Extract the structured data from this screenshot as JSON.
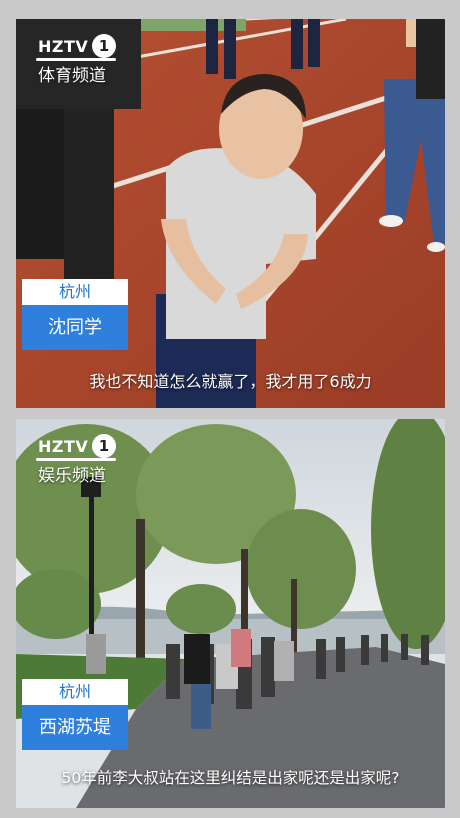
{
  "cards": [
    {
      "logo": {
        "brand": "HZTV",
        "number": "1",
        "channel": "体育频道"
      },
      "location": "杭州",
      "name": "沈同学",
      "caption": "我也不知道怎么就赢了，我才用了6成力"
    },
    {
      "logo": {
        "brand": "HZTV",
        "number": "1",
        "channel": "娱乐频道"
      },
      "location": "杭州",
      "name": "西湖苏堤",
      "caption": "50年前李大叔站在这里纠结是出家呢还是出家呢?"
    }
  ],
  "colors": {
    "tag_blue": "#2f80dc",
    "tag_city_text": "#1c74d4",
    "track": "#b0492f",
    "background": "#c9c9c9"
  }
}
